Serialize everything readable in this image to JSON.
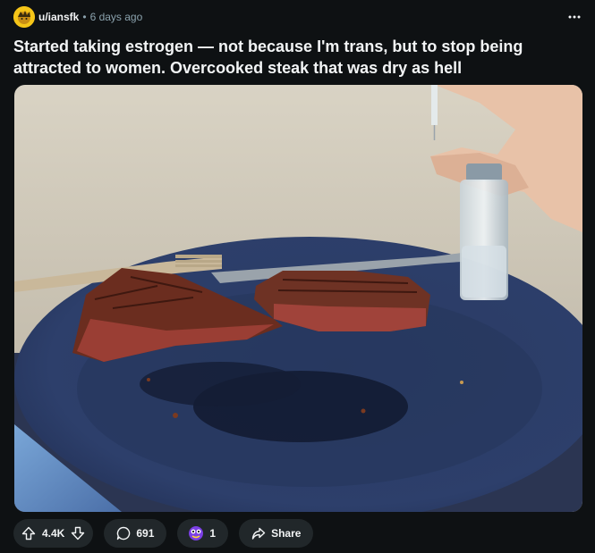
{
  "post": {
    "author": "u/iansfk",
    "separator": "•",
    "time": "6 days ago",
    "title": "Started taking estrogen — not because I'm trans, but to stop being attracted to women. Overcooked steak that was dry as hell"
  },
  "media": {
    "description_icon": "photo-steak-on-blue-plate"
  },
  "actions": {
    "votes": "4.4K",
    "comments": "691",
    "awards": "1",
    "share_label": "Share"
  },
  "colors": {
    "background": "#0e1113",
    "pill": "#21272a",
    "text": "#f2f4f5",
    "muted": "#8ba2ad",
    "avatar": "#f5c518"
  }
}
